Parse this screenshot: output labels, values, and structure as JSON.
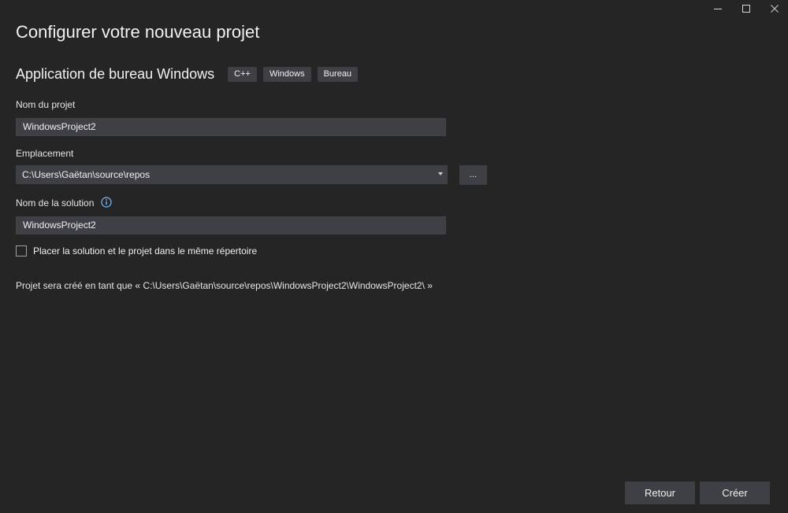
{
  "window": {
    "minimize_icon": "minimize-icon",
    "maximize_icon": "maximize-icon",
    "close_icon": "close-icon"
  },
  "page": {
    "title": "Configurer votre nouveau projet"
  },
  "template": {
    "name": "Application de bureau Windows",
    "tags": [
      "C++",
      "Windows",
      "Bureau"
    ]
  },
  "form": {
    "project_name_label": "Nom du projet",
    "project_name_value": "WindowsProject2",
    "location_label": "Emplacement",
    "location_value": "C:\\Users\\Gaëtan\\source\\repos",
    "browse_label": "...",
    "solution_name_label": "Nom de la solution",
    "solution_name_value": "WindowsProject2",
    "same_directory_label": "Placer la solution et le projet dans le même répertoire",
    "same_directory_checked": false,
    "path_info": "Projet sera créé en tant que « C:\\Users\\Gaëtan\\source\\repos\\WindowsProject2\\WindowsProject2\\ »"
  },
  "footer": {
    "back_label": "Retour",
    "create_label": "Créer"
  },
  "colors": {
    "background": "#252526",
    "control": "#3f3f46",
    "info_icon": "#75beff"
  }
}
